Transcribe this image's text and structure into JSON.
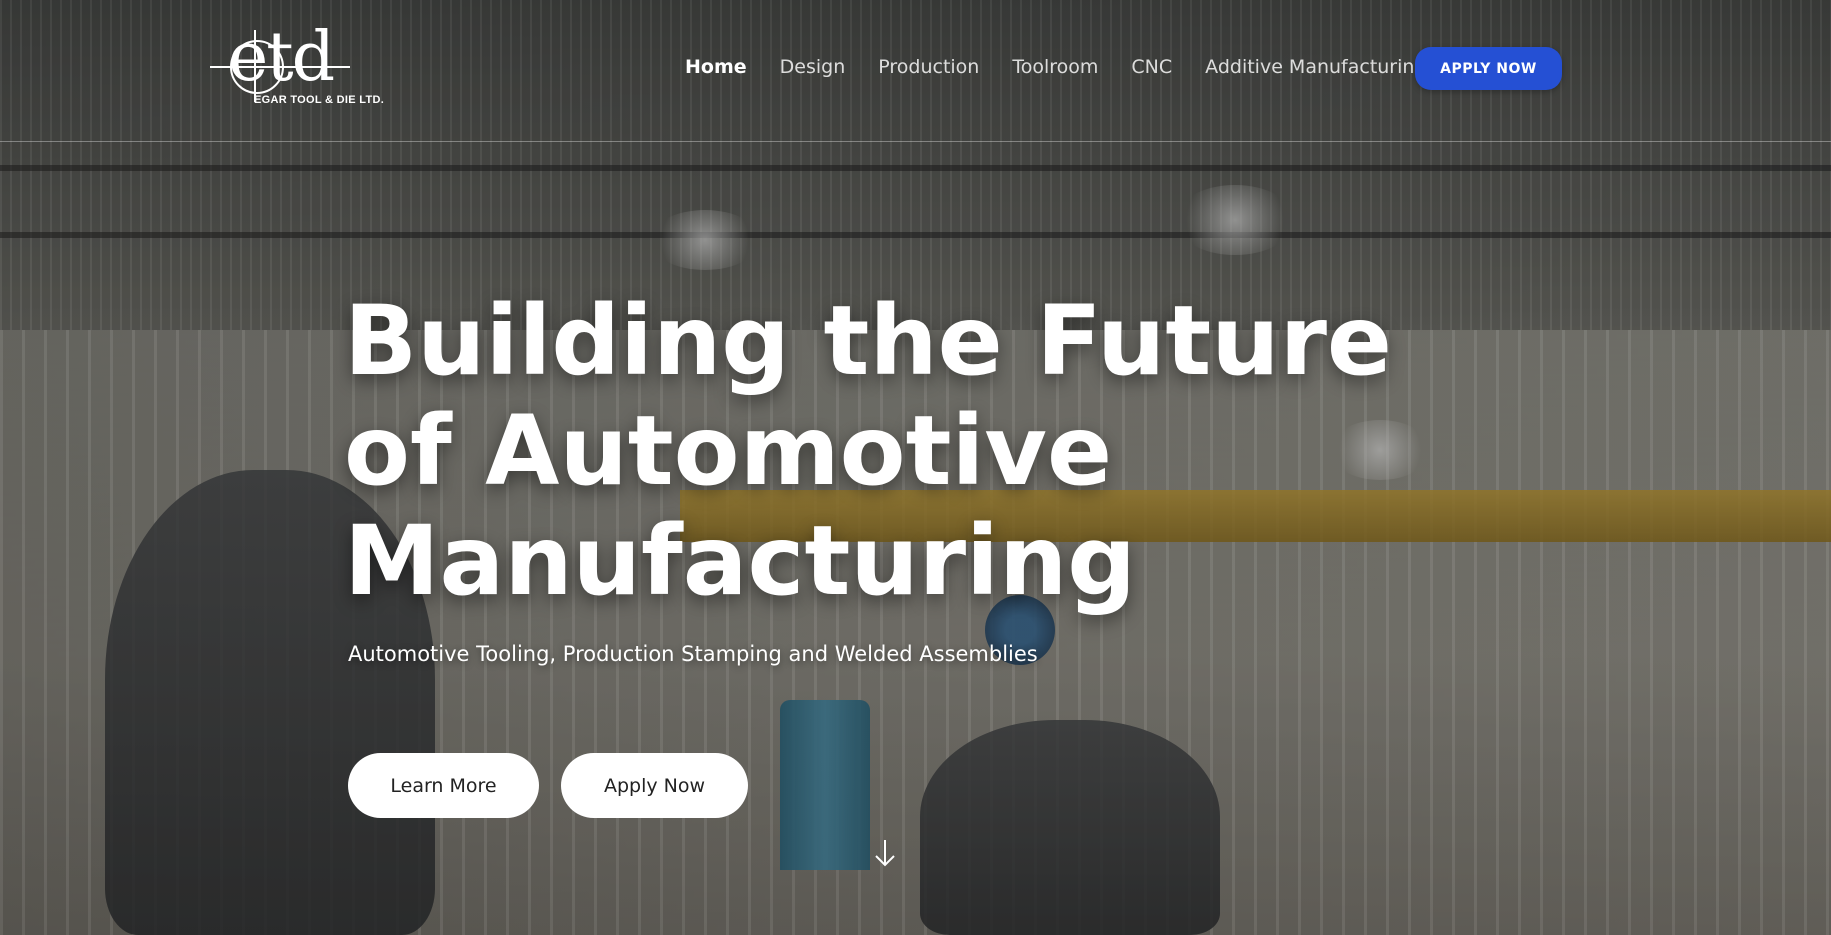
{
  "brand": {
    "logo_mark": "etd",
    "logo_subtitle": "EGAR TOOL & DIE LTD."
  },
  "nav": {
    "items": [
      {
        "label": "Home",
        "active": true
      },
      {
        "label": "Design"
      },
      {
        "label": "Production"
      },
      {
        "label": "Toolroom"
      },
      {
        "label": "CNC"
      },
      {
        "label": "Additive Manufacturing"
      }
    ],
    "cta_label": "APPLY NOW"
  },
  "hero": {
    "headline_line1": "Building the Future",
    "headline_line2": "of Automotive",
    "headline_line3": "Manufacturing",
    "subheadline": "Automotive Tooling, Production Stamping and Welded Assemblies",
    "learn_more_label": "Learn More",
    "apply_now_label": "Apply Now",
    "scroll_icon": "arrow-down-icon"
  },
  "colors": {
    "accent": "#2550d4",
    "text_light": "#ffffff",
    "button_bg": "#ffffff"
  }
}
